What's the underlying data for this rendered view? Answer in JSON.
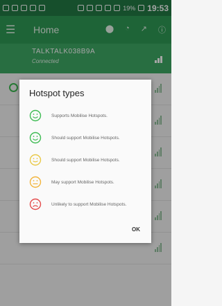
{
  "status_bar": {
    "battery": "19%",
    "time": "19:53"
  },
  "app_bar": {
    "title": "Home"
  },
  "current_network": {
    "name": "TALKTALK038B9A",
    "status": "Connected"
  },
  "dialog": {
    "title": "Hotspot types",
    "items": [
      {
        "label": "Supports Mobilise Hotspots.",
        "mood": "happy",
        "color": "#3dbb52"
      },
      {
        "label": "Should support Mobilise Hotspots.",
        "mood": "happy",
        "color": "#3dbb52"
      },
      {
        "label": "Should support Mobilise Hotspots.",
        "mood": "happy",
        "color": "#e9c845"
      },
      {
        "label": "May support Mobilise Hotspots.",
        "mood": "neutral",
        "color": "#f2b43b"
      },
      {
        "label": "Unlikely to support Mobilise Hotspots.",
        "mood": "sad",
        "color": "#e44b4b"
      }
    ],
    "ok_label": "OK"
  }
}
